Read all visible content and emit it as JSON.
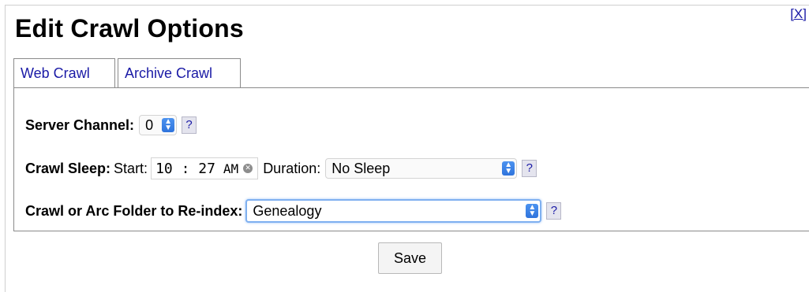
{
  "dialog": {
    "title": "Edit Crawl Options",
    "close_label": "[X]"
  },
  "tabs": [
    {
      "label": "Web Crawl",
      "active": false
    },
    {
      "label": "Archive Crawl",
      "active": true
    }
  ],
  "server_channel": {
    "label": "Server Channel:",
    "value": "0",
    "help": "?"
  },
  "crawl_sleep": {
    "label": "Crawl Sleep:",
    "start_label": "Start:",
    "start_time": "10 : 27",
    "start_ampm": "AM",
    "duration_label": "Duration:",
    "duration_value": "No Sleep",
    "help": "?"
  },
  "reindex": {
    "label": "Crawl or Arc Folder to Re-index:",
    "value": "Genealogy",
    "help": "?"
  },
  "save_label": "Save",
  "icons": {
    "select_chevron": "chevron-updown-icon",
    "clear": "clear-icon",
    "help": "help-icon"
  },
  "colors": {
    "link": "#1a1aa6",
    "focus_ring": "#7fb0f0",
    "chevron_bg": "#2f74dc"
  }
}
